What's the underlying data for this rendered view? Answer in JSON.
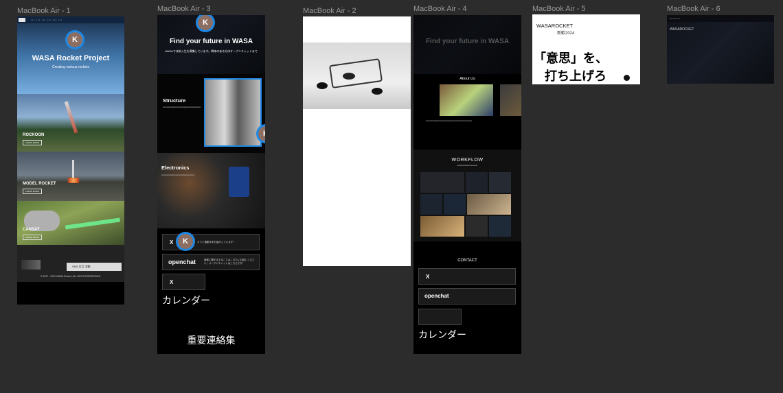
{
  "frames": {
    "f1": {
      "label": "MacBook Air - 1"
    },
    "f3": {
      "label": "MacBook Air - 3"
    },
    "f2": {
      "label": "MacBook Air - 2"
    },
    "f4": {
      "label": "MacBook Air - 4"
    },
    "f5": {
      "label": "MacBook Air - 5"
    },
    "f6": {
      "label": "MacBook Air - 6"
    }
  },
  "collaborator": {
    "initial": "K",
    "color": "#1e88e5"
  },
  "f1": {
    "hero_title": "WASA Rocket Project",
    "hero_subtitle": "Creating various rockets",
    "sections": [
      {
        "title": "ROCKOON",
        "button": "LEARN MORE"
      },
      {
        "title": "MODEL ROCKET",
        "button": "LEARN MORE"
      },
      {
        "title": "CANSAT",
        "button": "LEARN MORE"
      }
    ],
    "footer_button": "SNS 次点 活動",
    "copyright": "© 2007 - 2022 WASA Rocket, ALL RIGHTS RESERVED."
  },
  "f3": {
    "hero_title": "Find your future in WASA",
    "hero_subtitle": "WASAでは新入生を募集しています。興味のある方はオープンチャットまで",
    "structure_title": "Structure",
    "electronics_title": "Electronics",
    "x_text": "ろうと運動中をお届けしています！",
    "openchat_logo": "openchat",
    "openchat_text": "新歓に関するすることはこちらにお越しください！オープンチャットはこちらです！",
    "calendar": "カレンダー",
    "contacts": "重要連絡集"
  },
  "f4": {
    "hero_title": "Find your future in WASA",
    "about_title": "About Us",
    "workflow_title": "WORKFLOW",
    "contact_title": "CONTACT",
    "openchat_logo": "openchat",
    "calendar": "カレンダー"
  },
  "f5": {
    "brand": "WASAROCKET",
    "brand_sub": "新歓2024",
    "slogan_line1": "「意思」を、",
    "slogan_line2": "打ち上げろ"
  },
  "f6": {
    "brand": "WASAROCKET"
  }
}
